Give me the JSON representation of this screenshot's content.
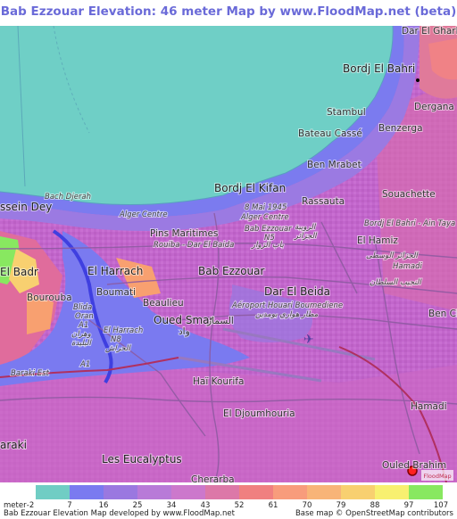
{
  "title": "Bab Ezzouar Elevation: 46 meter Map by www.FloodMap.net (beta)",
  "map": {
    "labels": {
      "dar_el_gharb": "Dar El Gharb 2",
      "bordj_el_bahri": "Bordj El Bahri",
      "tamentfoust": "Stambul",
      "dergana": "Dergana",
      "bateau_casse": "Bateau Cassé",
      "benzerga": "Benzerga",
      "ben_mrabet": "Ben Mrabet",
      "bach_djerah": "Bach Djerah",
      "hussein_dey": "ssein Dey",
      "bordj_el_kifan": "Bordj El Kifan",
      "souachette": "Souachette",
      "alger_centre_1": "Alger Centre",
      "mai_1945": "8 Mai 1945",
      "alger_centre_2": "Alger Centre",
      "rassauta": "Rassauta",
      "bab_ezzouar_n5": "Bab Ezzouar",
      "n5": "N5",
      "arabic_rouiba": "الرويبة",
      "arabic_hamiz": "الجزائر",
      "pins_maritimes": "Pins Maritimes",
      "bordj_el_bahri_ain_taya": "Bordj El Bahri - Ain Taya",
      "rouiba_dar_el_baida": "Rouiba - Dar El Baida",
      "arabic_bab_el_baida": "باب الزوار",
      "el_hamiz": "El Hamiz",
      "el_badr": "El Badr",
      "el_harrach": "El Harrach",
      "bab_ezzouar": "Bab Ezzouar",
      "arabic_hamiz_2": "الجزائر الوسطى",
      "hamadi_1": "Hamadi",
      "arabic_hamadi": "النجيب السلطان",
      "bourouba": "Bourouba",
      "boumati": "Boumati",
      "dar_el_beida": "Dar El Beida",
      "aeroport": "Aéroport Houari Boumediene",
      "arabic_aeroport": "مطار هواري بومدين",
      "beaulieu": "Beaulieu",
      "blida_oran": "Blida",
      "oran": "Oran",
      "a1": "A1",
      "arabic_blida": "وهران",
      "arabic_blida_2": "البليدة",
      "oued_smar": "Oued Smar",
      "arabic_oued_smar": "السمار",
      "arabic_oued_smar_2": "واد",
      "el_harrach_n8": "El Harrach",
      "n8": "N8",
      "arabic_el_harrach": "الحراش",
      "ben_ch": "Ben Ch",
      "a1_b": "A1",
      "baraki_est": "Baraki Est",
      "hai_kourifa": "Haï Kourifa",
      "el_djoumhouria": "El Djoumhouria",
      "hamadi_2": "Hamadi",
      "baraki": "araki",
      "les_eucalyptus": "Les Eucalyptus",
      "ouled_brahim": "Ouled Brahim",
      "cherarba": "Cherarba"
    }
  },
  "legend": {
    "unit": "meter",
    "ticks": [
      "-2",
      "7",
      "16",
      "25",
      "34",
      "43",
      "52",
      "61",
      "70",
      "79",
      "88",
      "97",
      "107"
    ],
    "colors": [
      "#70cdc4",
      "#7a7af0",
      "#9a78e0",
      "#b87ad8",
      "#cc78cc",
      "#dc78a8",
      "#f08080",
      "#f89c7c",
      "#f8b478",
      "#f8d070",
      "#f8f070",
      "#88e860"
    ]
  },
  "footer": {
    "left": "Bab Ezzouar Elevation Map developed by www.FloodMap.net",
    "right": "Base map © OpenStreetMap contributors"
  },
  "watermark": "FloodMap"
}
